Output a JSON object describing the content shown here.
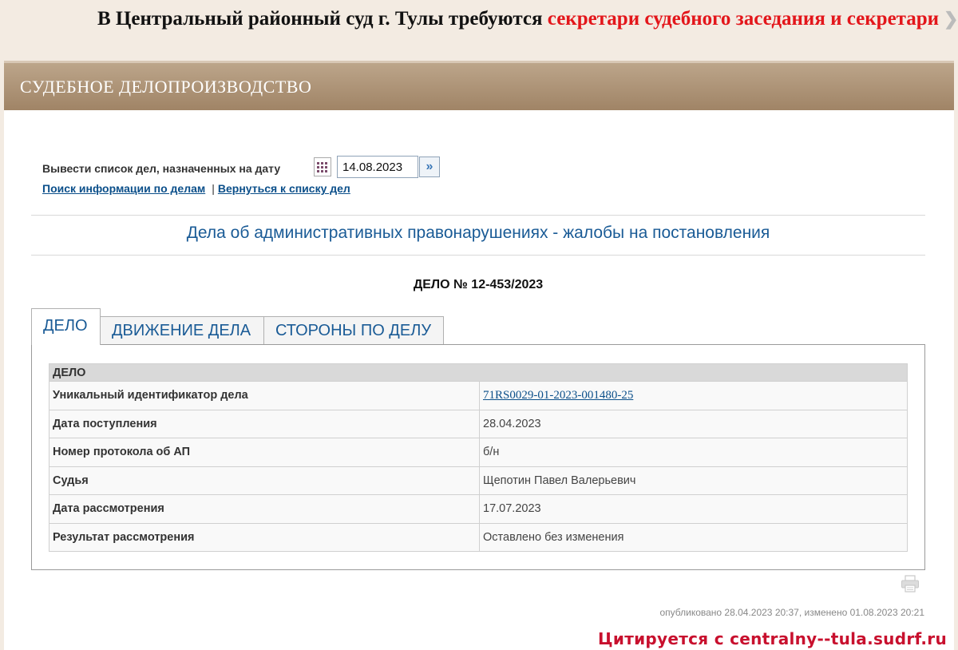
{
  "ticker": {
    "text_black": "В Центральный районный суд г. Тулы требуются ",
    "text_red": "секретари судебного заседания и секретари с"
  },
  "header": {
    "title": "СУДЕБНОЕ ДЕЛОПРОИЗВОДСТВО"
  },
  "datebar": {
    "label": "Вывести список дел, назначенных на дату",
    "date_value": "14.08.2023",
    "calendar_icon": "calendar-icon",
    "go_icon": "double-chevron-right-icon"
  },
  "links": {
    "search": "Поиск информации по делам",
    "separator": "|",
    "back": "Вернуться к списку дел"
  },
  "category": "Дела об административных правонарушениях - жалобы на постановления",
  "case_number": "ДЕЛО № 12-453/2023",
  "tabs": [
    "ДЕЛО",
    "ДВИЖЕНИЕ ДЕЛА",
    "СТОРОНЫ ПО ДЕЛУ"
  ],
  "case_table": {
    "header": "ДЕЛО",
    "rows": [
      {
        "label": "Уникальный идентификатор дела",
        "value": "71RS0029-01-2023-001480-25"
      },
      {
        "label": "Дата поступления",
        "value": "28.04.2023"
      },
      {
        "label": "Номер протокола об АП",
        "value": "б/н"
      },
      {
        "label": "Судья",
        "value": "Щепотин Павел Валерьевич"
      },
      {
        "label": "Дата рассмотрения",
        "value": "17.07.2023"
      },
      {
        "label": "Результат рассмотрения",
        "value": "Оставлено без изменения"
      }
    ]
  },
  "print_icon": "printer-icon",
  "published": "опубликовано 28.04.2023 20:37, изменено 01.08.2023 20:21",
  "watermark": "Цитируется с centralny--tula.sudrf.ru",
  "colors": {
    "header": "#a08466",
    "link": "#0b4f8a",
    "accent_red": "#e3161b",
    "page_bg": "#f3ebe2"
  }
}
